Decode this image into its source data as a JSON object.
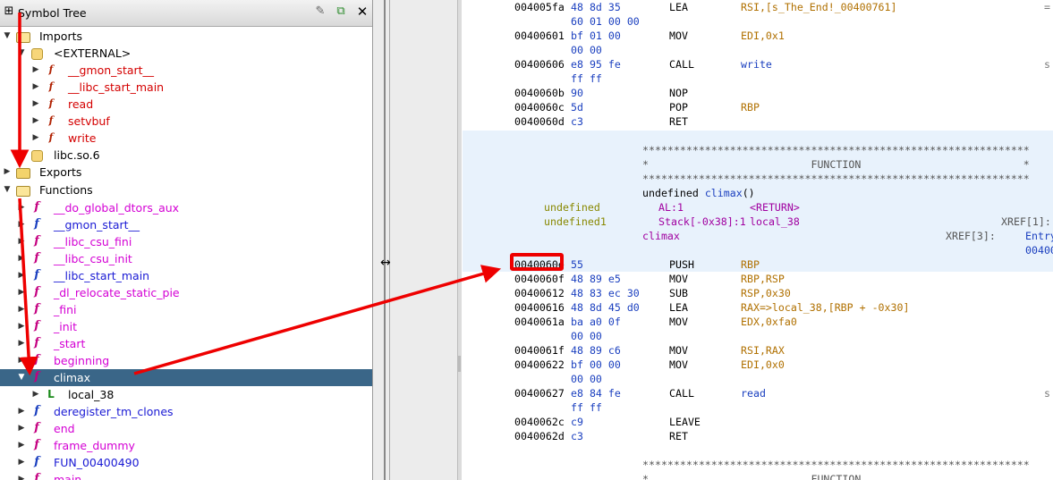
{
  "symbol_tree": {
    "title": "Symbol Tree",
    "imports": "Imports",
    "external": "<EXTERNAL>",
    "external_items": [
      "__gmon_start__",
      "__libc_start_main",
      "read",
      "setvbuf",
      "write"
    ],
    "libc": "libc.so.6",
    "exports": "Exports",
    "functions": "Functions",
    "function_items": [
      "__do_global_dtors_aux",
      "__gmon_start__",
      "__libc_csu_fini",
      "__libc_csu_init",
      "__libc_start_main",
      "_dl_relocate_static_pie",
      "_fini",
      "_init",
      "_start",
      "beginning",
      "climax"
    ],
    "local_var": "local_38",
    "function_items_after": [
      "deregister_tm_clones",
      "end",
      "frame_dummy",
      "FUN_00400490",
      "main"
    ]
  },
  "listing": {
    "rows_top": [
      {
        "addr": "004005fa",
        "bytes": "48 8d 35",
        "mnem": "LEA",
        "ops": "RSI,[s_The_End!_00400761]",
        "extra": "="
      },
      {
        "addr": "",
        "bytes": "60 01 00 00",
        "mnem": "",
        "ops": "",
        "extra": ""
      },
      {
        "addr": "00400601",
        "bytes": "bf 01 00",
        "mnem": "MOV",
        "ops": "EDI,0x1",
        "extra": ""
      },
      {
        "addr": "",
        "bytes": "00 00",
        "mnem": "",
        "ops": "",
        "extra": ""
      },
      {
        "addr": "00400606",
        "bytes": "e8 95 fe",
        "mnem": "CALL",
        "ops": "write",
        "extra": "s"
      },
      {
        "addr": "",
        "bytes": "ff ff",
        "mnem": "",
        "ops": "",
        "extra": ""
      },
      {
        "addr": "0040060b",
        "bytes": "90",
        "mnem": "NOP",
        "ops": "",
        "extra": ""
      },
      {
        "addr": "0040060c",
        "bytes": "5d",
        "mnem": "POP",
        "ops": "RBP",
        "extra": ""
      },
      {
        "addr": "0040060d",
        "bytes": "c3",
        "mnem": "RET",
        "ops": "",
        "extra": ""
      }
    ],
    "stars": "**************************************************************",
    "function_banner": "*                          FUNCTION                          *",
    "signature_prefix": "undefined ",
    "signature_name": "climax",
    "signature_suffix": "()",
    "ret_type": "undefined",
    "ret_loc": "AL:1",
    "ret_name": "<RETURN>",
    "var_type": "undefined1",
    "var_loc": "Stack[-0x38]:1",
    "var_name": "local_38",
    "var_xref": "XREF[1]:",
    "label": "climax",
    "label_xref": "XREF[3]:",
    "label_xref_val1": "Entry",
    "label_xref_val2": "00400",
    "rows_bottom": [
      {
        "addr": "0040060e",
        "bytes": "55",
        "mnem": "PUSH",
        "ops": "RBP",
        "extra": ""
      },
      {
        "addr": "0040060f",
        "bytes": "48 89 e5",
        "mnem": "MOV",
        "ops": "RBP,RSP",
        "extra": ""
      },
      {
        "addr": "00400612",
        "bytes": "48 83 ec 30",
        "mnem": "SUB",
        "ops": "RSP,0x30",
        "extra": ""
      },
      {
        "addr": "00400616",
        "bytes": "48 8d 45 d0",
        "mnem": "LEA",
        "ops": "RAX=>local_38,[RBP + -0x30]",
        "extra": ""
      },
      {
        "addr": "0040061a",
        "bytes": "ba a0 0f",
        "mnem": "MOV",
        "ops": "EDX,0xfa0",
        "extra": ""
      },
      {
        "addr": "",
        "bytes": "00 00",
        "mnem": "",
        "ops": "",
        "extra": ""
      },
      {
        "addr": "0040061f",
        "bytes": "48 89 c6",
        "mnem": "MOV",
        "ops": "RSI,RAX",
        "extra": ""
      },
      {
        "addr": "00400622",
        "bytes": "bf 00 00",
        "mnem": "MOV",
        "ops": "EDI,0x0",
        "extra": ""
      },
      {
        "addr": "",
        "bytes": "00 00",
        "mnem": "",
        "ops": "",
        "extra": ""
      },
      {
        "addr": "00400627",
        "bytes": "e8 84 fe",
        "mnem": "CALL",
        "ops": "read",
        "extra": "s"
      },
      {
        "addr": "",
        "bytes": "ff ff",
        "mnem": "",
        "ops": "",
        "extra": ""
      },
      {
        "addr": "0040062c",
        "bytes": "c9",
        "mnem": "LEAVE",
        "ops": "",
        "extra": ""
      },
      {
        "addr": "0040062d",
        "bytes": "c3",
        "mnem": "RET",
        "ops": "",
        "extra": ""
      }
    ],
    "next_banner": "*                          FUNCTION"
  },
  "colors": {
    "selection": "#3a6688",
    "annotation_red": "#ee0000",
    "function_block_bg": "#e8f2fc"
  }
}
